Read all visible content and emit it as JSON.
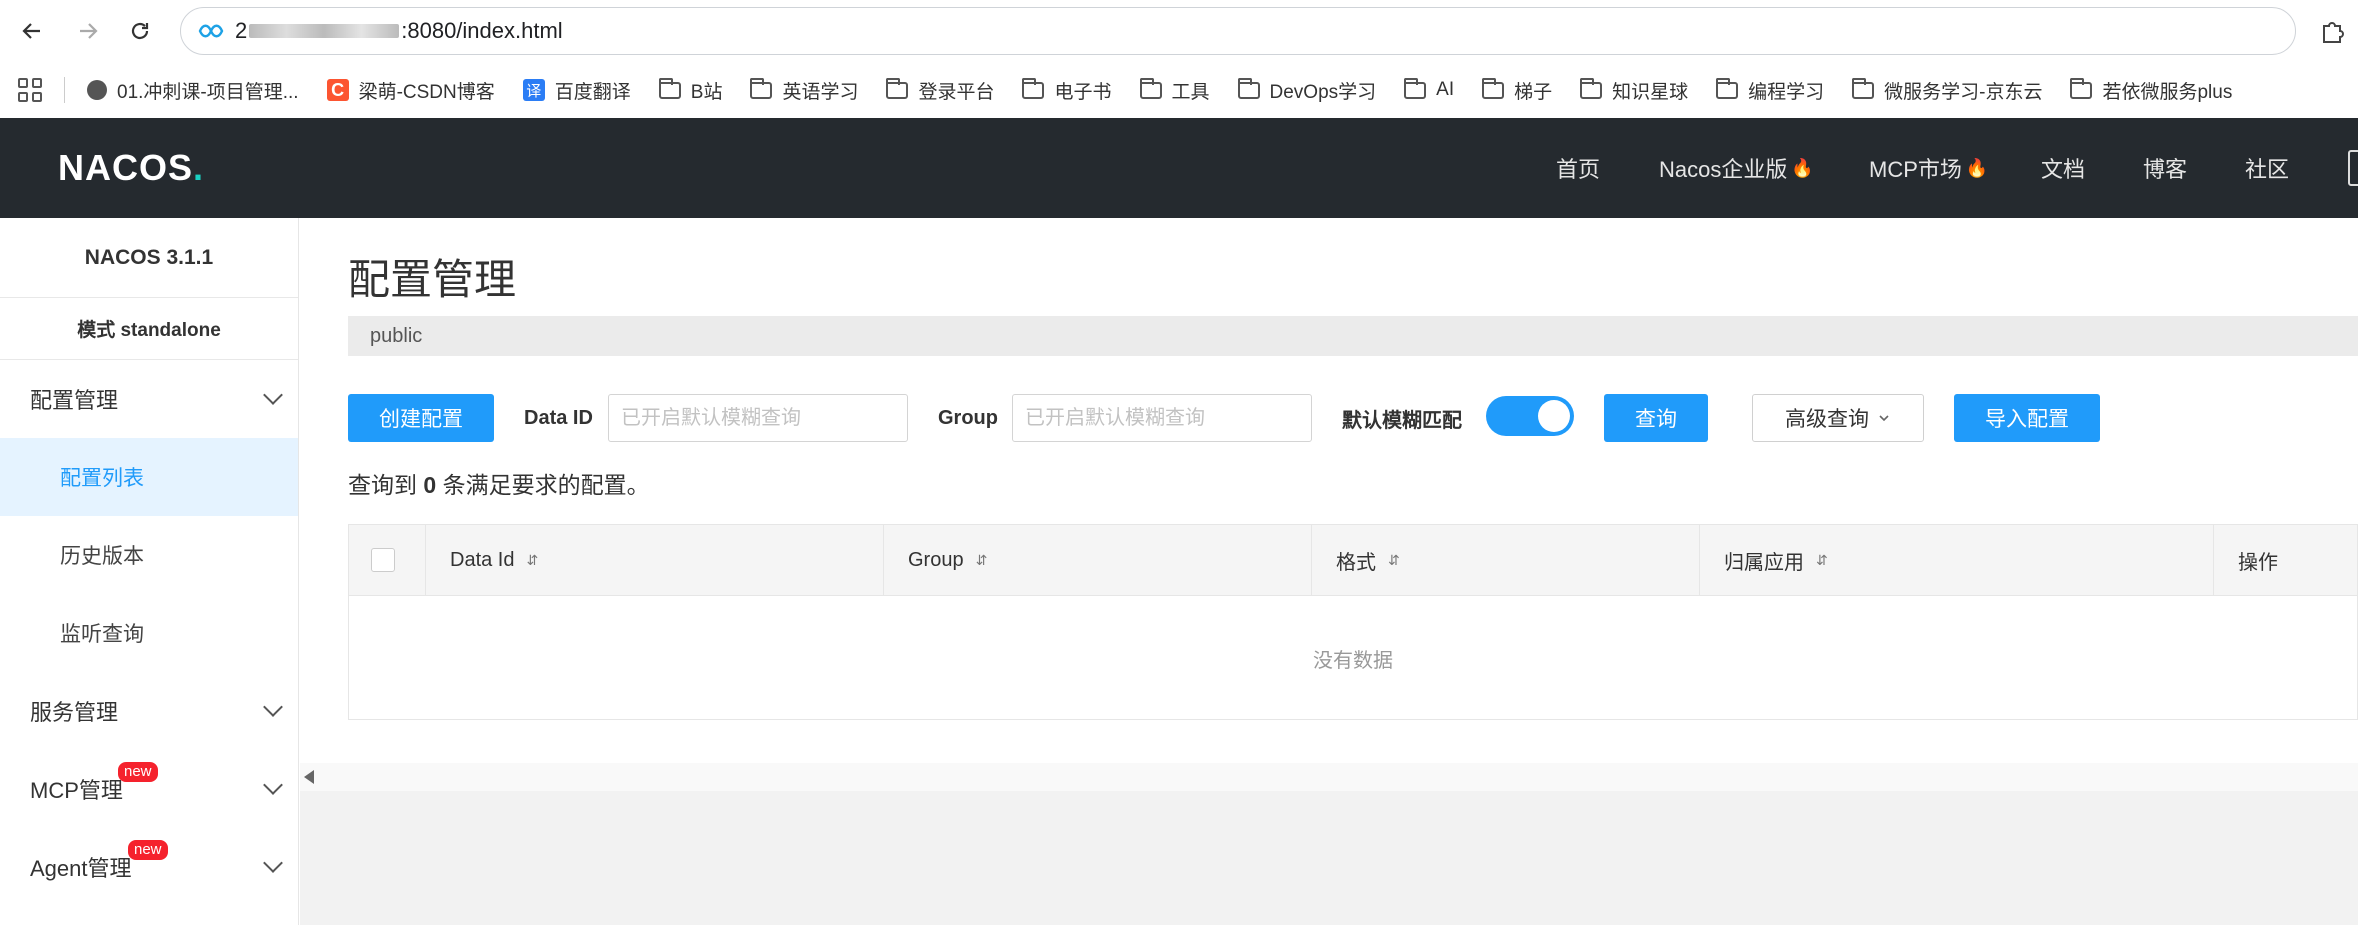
{
  "browser": {
    "address_prefix": "2",
    "address_suffix": ":8080/index.html"
  },
  "bookmarks": [
    {
      "label": "01.冲刺课-项目管理...",
      "icon": "globe-icon"
    },
    {
      "label": "梁萌-CSDN博客",
      "icon": "csdn-icon"
    },
    {
      "label": "百度翻译",
      "icon": "translate-icon"
    },
    {
      "label": "B站",
      "icon": "folder-icon"
    },
    {
      "label": "英语学习",
      "icon": "folder-icon"
    },
    {
      "label": "登录平台",
      "icon": "folder-icon"
    },
    {
      "label": "电子书",
      "icon": "folder-icon"
    },
    {
      "label": "工具",
      "icon": "folder-icon"
    },
    {
      "label": "DevOps学习",
      "icon": "folder-icon"
    },
    {
      "label": "AI",
      "icon": "folder-icon"
    },
    {
      "label": "梯子",
      "icon": "folder-icon"
    },
    {
      "label": "知识星球",
      "icon": "folder-icon"
    },
    {
      "label": "编程学习",
      "icon": "folder-icon"
    },
    {
      "label": "微服务学习-京东云",
      "icon": "folder-icon"
    },
    {
      "label": "若依微服务plus",
      "icon": "folder-icon"
    }
  ],
  "header": {
    "logo": "NACOS",
    "logo_dot": ".",
    "nav": {
      "home": "首页",
      "enterprise": "Nacos企业版",
      "mcp_market": "MCP市场",
      "docs": "文档",
      "blog": "博客",
      "community": "社区"
    }
  },
  "sidebar": {
    "version": "NACOS 3.1.1",
    "mode": "模式 standalone",
    "config_group": "配置管理",
    "config_items": [
      "配置列表",
      "历史版本",
      "监听查询"
    ],
    "service_group": "服务管理",
    "mcp_group": "MCP管理",
    "agent_group": "Agent管理",
    "new_badge": "new"
  },
  "main": {
    "title": "配置管理",
    "namespace": "public",
    "toolbar": {
      "create_label": "创建配置",
      "data_id_label": "Data ID",
      "data_id_placeholder": "已开启默认模糊查询",
      "group_label": "Group",
      "group_placeholder": "已开启默认模糊查询",
      "fuzzy_label": "默认模糊匹配",
      "fuzzy_enabled": true,
      "query_label": "查询",
      "advanced_label": "高级查询",
      "import_label": "导入配置"
    },
    "result": {
      "prefix": "查询到",
      "count": "0",
      "suffix": "条满足要求的配置。"
    },
    "table": {
      "columns": [
        "Data Id",
        "Group",
        "格式",
        "归属应用",
        "操作"
      ],
      "empty_text": "没有数据"
    }
  },
  "colors": {
    "primary": "#209bfa",
    "header_bg": "#252a2f",
    "active_menu_bg": "#e5f3ff",
    "badge": "#f5222d"
  }
}
